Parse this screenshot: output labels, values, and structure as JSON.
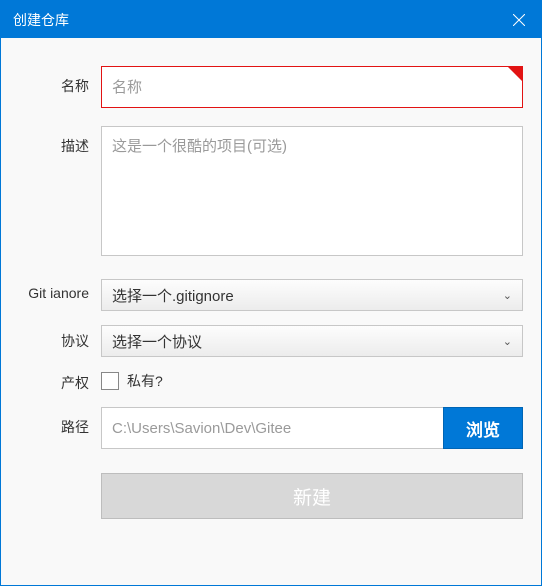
{
  "title": "创建仓库",
  "labels": {
    "name": "名称",
    "desc": "描述",
    "gitignore": "Git ianore",
    "license": "协议",
    "ownership": "产权",
    "path": "路径"
  },
  "placeholders": {
    "name": "名称",
    "desc": "这是一个很酷的项目(可选)"
  },
  "selects": {
    "gitignore": "选择一个.gitignore",
    "license": "选择一个协议"
  },
  "private_label": "私有?",
  "path_value": "C:\\Users\\Savion\\Dev\\Gitee",
  "buttons": {
    "browse": "浏览",
    "create": "新建"
  },
  "colors": {
    "accent": "#0078d7",
    "error": "#e21313"
  }
}
